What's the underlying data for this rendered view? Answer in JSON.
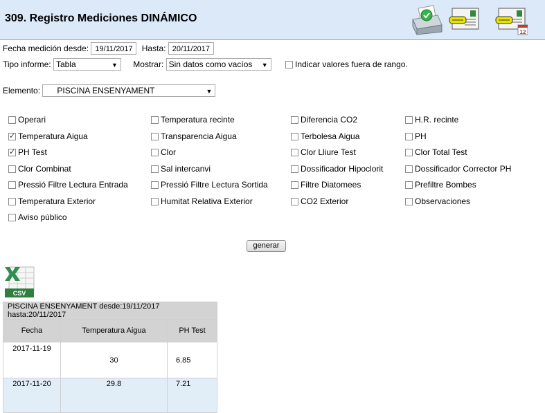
{
  "header": {
    "title": "309. Registro Mediciones DINÁMICO",
    "icons": [
      "printer-icon",
      "email-card-icon",
      "email-calendar-icon"
    ],
    "calendar_badge": "12"
  },
  "filters": {
    "fecha_label": "Fecha medición desde:",
    "desde": "19/11/2017",
    "hasta_label": "Hasta:",
    "hasta": "20/11/2017",
    "tipo_label": "Tipo informe:",
    "tipo_value": "Tabla",
    "mostrar_label": "Mostrar:",
    "mostrar_value": "Sin datos como vacíos",
    "rango_label": "Indicar valores fuera de rango.",
    "elemento_label": "Elemento:",
    "elemento_value": "PISCINA ENSENYAMENT"
  },
  "checkboxes": [
    {
      "label": "Operari",
      "checked": false
    },
    {
      "label": "Temperatura recinte",
      "checked": false
    },
    {
      "label": "Diferencia CO2",
      "checked": false
    },
    {
      "label": "H.R. recinte",
      "checked": false
    },
    {
      "label": "Temperatura Aigua",
      "checked": true
    },
    {
      "label": "Transparencia Aigua",
      "checked": false
    },
    {
      "label": "Terbolesa Aigua",
      "checked": false
    },
    {
      "label": "PH",
      "checked": false
    },
    {
      "label": "PH Test",
      "checked": true
    },
    {
      "label": "Clor",
      "checked": false
    },
    {
      "label": "Clor Lliure Test",
      "checked": false
    },
    {
      "label": "Clor Total Test",
      "checked": false
    },
    {
      "label": "Clor Combinat",
      "checked": false
    },
    {
      "label": "Sal intercanvi",
      "checked": false
    },
    {
      "label": "Dossificador Hipoclorit",
      "checked": false
    },
    {
      "label": "Dossificador Corrector PH",
      "checked": false
    },
    {
      "label": "Pressió Filtre Lectura Entrada",
      "checked": false
    },
    {
      "label": "Pressió Filtre Lectura Sortida",
      "checked": false
    },
    {
      "label": "Filtre Diatomees",
      "checked": false
    },
    {
      "label": "Prefiltre Bombes",
      "checked": false
    },
    {
      "label": "Temperatura Exterior",
      "checked": false
    },
    {
      "label": "Humitat Relativa Exterior",
      "checked": false
    },
    {
      "label": "CO2 Exterior",
      "checked": false
    },
    {
      "label": "Observaciones",
      "checked": false
    },
    {
      "label": "Aviso público",
      "checked": false
    }
  ],
  "generate_label": "generar",
  "csv_label": "CSV",
  "table": {
    "caption": "PISCINA ENSENYAMENT desde:19/11/2017 hasta:20/11/2017",
    "headers": [
      "Fecha",
      "Temperatura Aigua",
      "PH Test"
    ],
    "rows": [
      [
        "2017-11-19",
        "30",
        "6.85"
      ],
      [
        "2017-11-20",
        "29.8",
        "7.21"
      ]
    ],
    "row_colors": [
      "#ffffff",
      "#e2eef7"
    ]
  }
}
